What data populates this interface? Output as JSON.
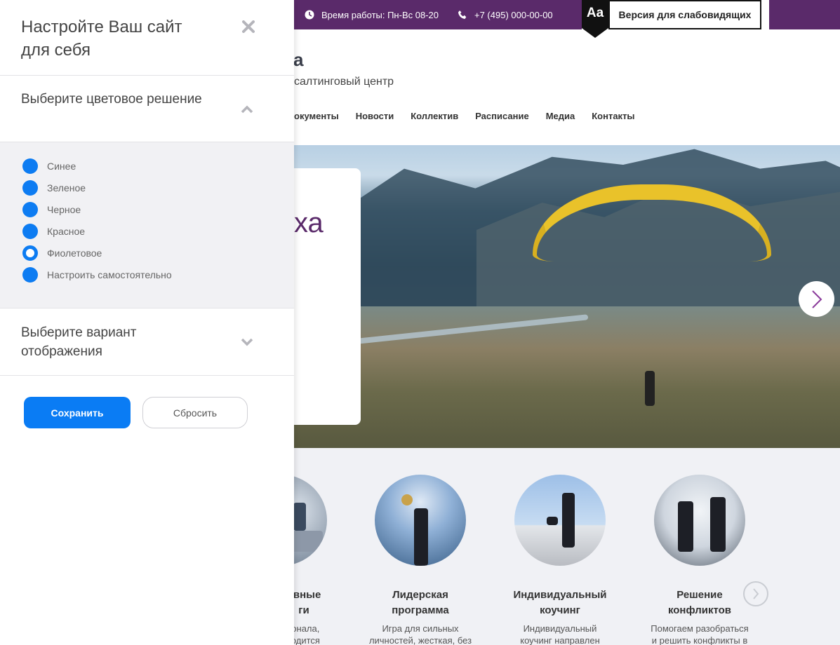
{
  "topbar": {
    "hours": "Время работы: Пн-Вс 08-20",
    "phone": "+7 (495) 000-00-00",
    "accessibility_badge": "Aa",
    "accessibility_label": "Версия для слабовидящих",
    "bg_color": "#5a2a6a"
  },
  "header": {
    "logo_tail": "а",
    "subtitle": "салтинговый центр",
    "nav": [
      "окументы",
      "Новости",
      "Коллектив",
      "Расписание",
      "Медиа",
      "Контакты"
    ]
  },
  "hero": {
    "text_fragment": "ха"
  },
  "services": [
    {
      "title": "ивные\nги",
      "desc": "сонала,\nводится"
    },
    {
      "title": "Лидерская\nпрограмма",
      "desc": "Игра для сильных\nличностей, жесткая, без"
    },
    {
      "title": "Индивидуальный\nкоучинг",
      "desc": "Индивидуальный\nкоучинг направлен"
    },
    {
      "title": "Решение\nконфликтов",
      "desc": "Помогаем разобраться\nи решить конфликты в"
    }
  ],
  "panel": {
    "title": "Настройте Ваш сайт для себя",
    "close_icon": "close-icon",
    "color_section_title": "Выберите цветовое решение",
    "color_options": [
      {
        "label": "Синее",
        "selected": false
      },
      {
        "label": "Зеленое",
        "selected": false
      },
      {
        "label": "Черное",
        "selected": false
      },
      {
        "label": "Красное",
        "selected": false
      },
      {
        "label": "Фиолетовое",
        "selected": true
      },
      {
        "label": "Настроить самостоятельно",
        "selected": false
      }
    ],
    "display_section_title": "Выберите вариант отображения",
    "save_label": "Сохранить",
    "reset_label": "Сбросить",
    "accent_color": "#0a7cf4"
  }
}
